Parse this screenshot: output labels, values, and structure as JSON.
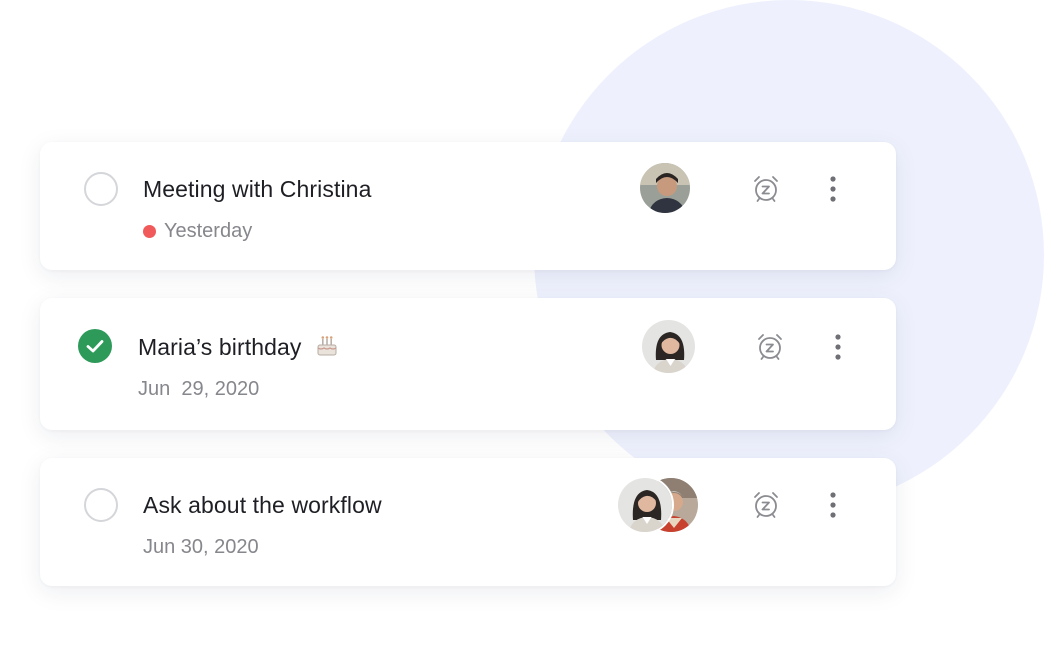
{
  "tasks": [
    {
      "title": "Meeting with Christina",
      "date": "Yesterday",
      "done": false,
      "overdue": true,
      "assignees": [
        "avatar-man"
      ]
    },
    {
      "title": "Maria’s birthday",
      "date": "Jun  29, 2020",
      "done": true,
      "overdue": false,
      "emoji": "birthday-cake-icon",
      "assignees": [
        "avatar-woman"
      ]
    },
    {
      "title": "Ask about the workflow",
      "date": "Jun 30, 2020",
      "done": false,
      "overdue": false,
      "assignees": [
        "avatar-woman",
        "avatar-person-2"
      ]
    }
  ],
  "icons": {
    "reminder": "alarm-clock-icon",
    "more": "more-vertical-icon",
    "check": "checkmark-icon"
  },
  "colors": {
    "done_green": "#2e9a5a",
    "overdue_red": "#f05a5a",
    "background_circle": "#eef1fd",
    "text": "#1e1f24",
    "muted": "#86878c"
  }
}
